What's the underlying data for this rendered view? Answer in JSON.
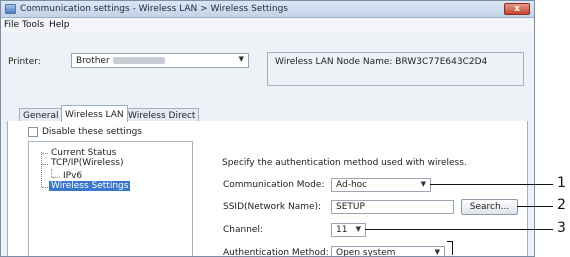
{
  "window": {
    "title": "Communication settings - Wireless LAN > Wireless Settings",
    "close_symbol": "x"
  },
  "menu": [
    "File",
    "Tools",
    "Help"
  ],
  "printer": {
    "label": "Printer:",
    "value": "Brother"
  },
  "node_name": "Wireless LAN Node Name: BRW3C77E643C2D4",
  "tabs": [
    "General",
    "Wireless LAN",
    "Wireless Direct"
  ],
  "disable_label": "Disable these settings",
  "tree": [
    "Current Status",
    "TCP/IP(Wireless)",
    "IPv6",
    "Wireless Settings"
  ],
  "description": "Specify the authentication method used with wireless.",
  "fields": {
    "comm_mode_label": "Communication Mode:",
    "comm_mode_value": "Ad-hoc",
    "ssid_label": "SSID(Network Name):",
    "ssid_value": "SETUP",
    "search_button": "Search...",
    "channel_label": "Channel:",
    "channel_value": "11",
    "auth_label": "Authentication Method:",
    "auth_value": "Open system"
  },
  "callouts": [
    "1",
    "2",
    "3"
  ],
  "icons": {
    "dropdown": "chevron-down-icon",
    "app": "app-window-icon"
  },
  "colors": {
    "selection": "#3a78cf",
    "close_button": "#c3462e"
  }
}
